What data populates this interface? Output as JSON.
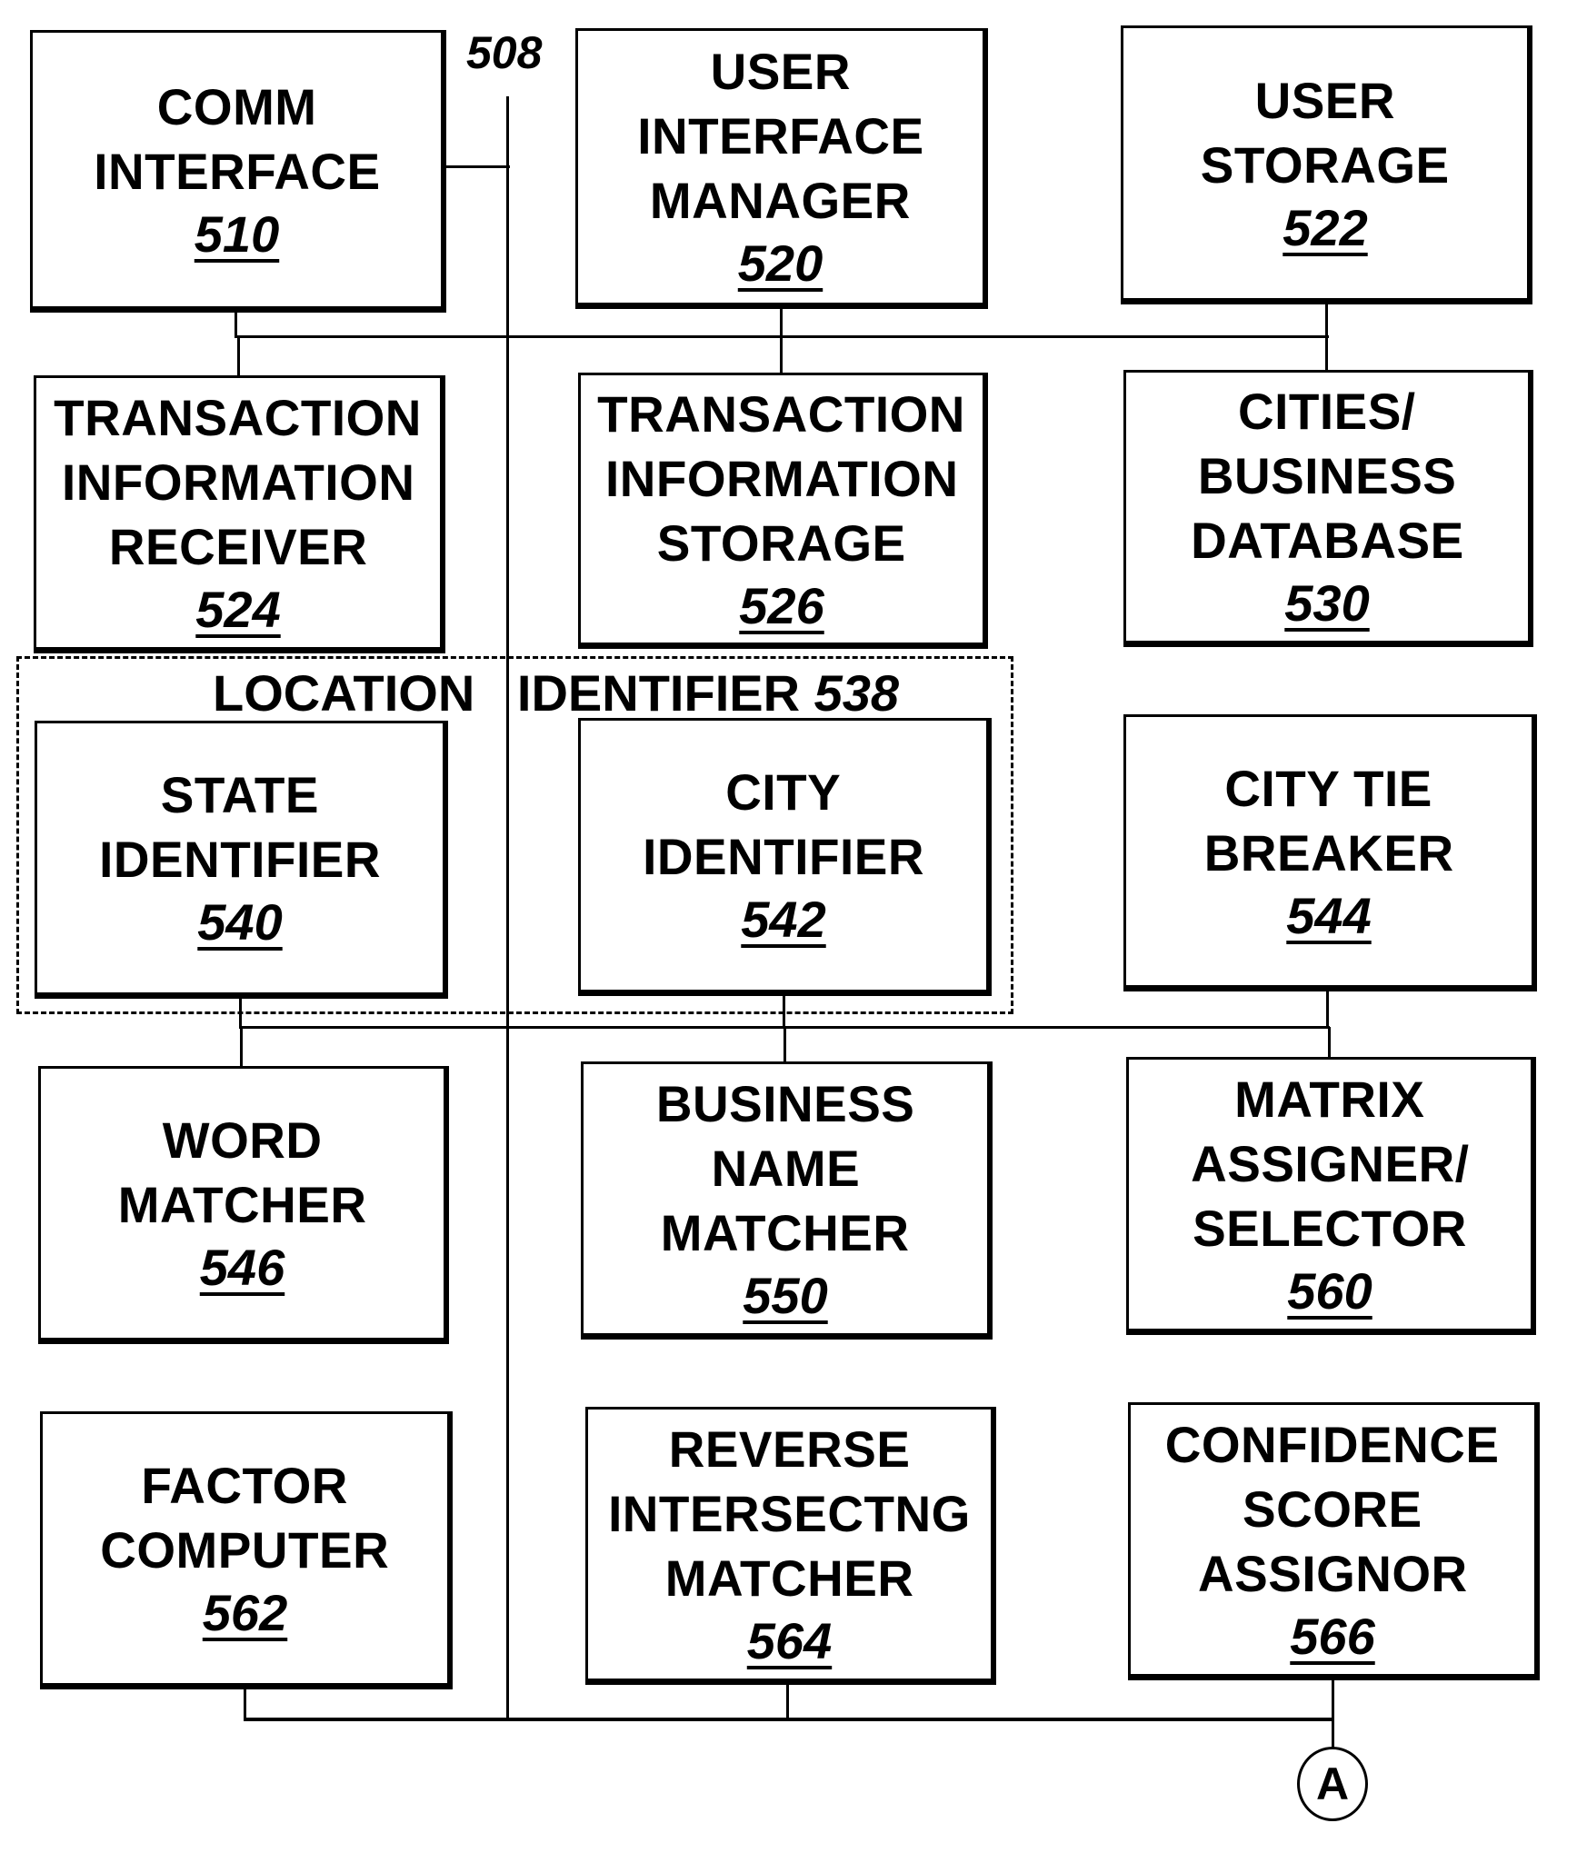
{
  "diagram": {
    "ref_label_508": "508",
    "group": {
      "title": "LOCATION   IDENTIFIER",
      "ref": "538"
    },
    "connector": {
      "label": "A"
    },
    "boxes": [
      {
        "id": "comm-interface",
        "lines": [
          "COMM",
          "INTERFACE"
        ],
        "ref": "510"
      },
      {
        "id": "user-interface-manager",
        "lines": [
          "USER",
          "INTERFACE",
          "MANAGER"
        ],
        "ref": "520"
      },
      {
        "id": "user-storage",
        "lines": [
          "USER",
          "STORAGE"
        ],
        "ref": "522"
      },
      {
        "id": "transaction-information-receiver",
        "lines": [
          "TRANSACTION",
          "INFORMATION",
          "RECEIVER"
        ],
        "ref": "524"
      },
      {
        "id": "transaction-information-storage",
        "lines": [
          "TRANSACTION",
          "INFORMATION",
          "STORAGE"
        ],
        "ref": "526"
      },
      {
        "id": "cities-business-database",
        "lines": [
          "CITIES/",
          "BUSINESS",
          "DATABASE"
        ],
        "ref": "530"
      },
      {
        "id": "state-identifier",
        "lines": [
          "STATE",
          "IDENTIFIER"
        ],
        "ref": "540"
      },
      {
        "id": "city-identifier",
        "lines": [
          "CITY",
          "IDENTIFIER"
        ],
        "ref": "542"
      },
      {
        "id": "city-tie-breaker",
        "lines": [
          "CITY TIE",
          "BREAKER"
        ],
        "ref": "544"
      },
      {
        "id": "word-matcher",
        "lines": [
          "WORD",
          "MATCHER"
        ],
        "ref": "546"
      },
      {
        "id": "business-name-matcher",
        "lines": [
          "BUSINESS",
          "NAME",
          "MATCHER"
        ],
        "ref": "550"
      },
      {
        "id": "matrix-assigner-selector",
        "lines": [
          "MATRIX",
          "ASSIGNER/",
          "SELECTOR"
        ],
        "ref": "560"
      },
      {
        "id": "factor-computer",
        "lines": [
          "FACTOR",
          "COMPUTER"
        ],
        "ref": "562"
      },
      {
        "id": "reverse-intersectng-matcher",
        "lines": [
          "REVERSE",
          "INTERSECTNG",
          "MATCHER"
        ],
        "ref": "564"
      },
      {
        "id": "confidence-score-assignor",
        "lines": [
          "CONFIDENCE",
          "SCORE",
          "ASSIGNOR"
        ],
        "ref": "566"
      }
    ]
  }
}
